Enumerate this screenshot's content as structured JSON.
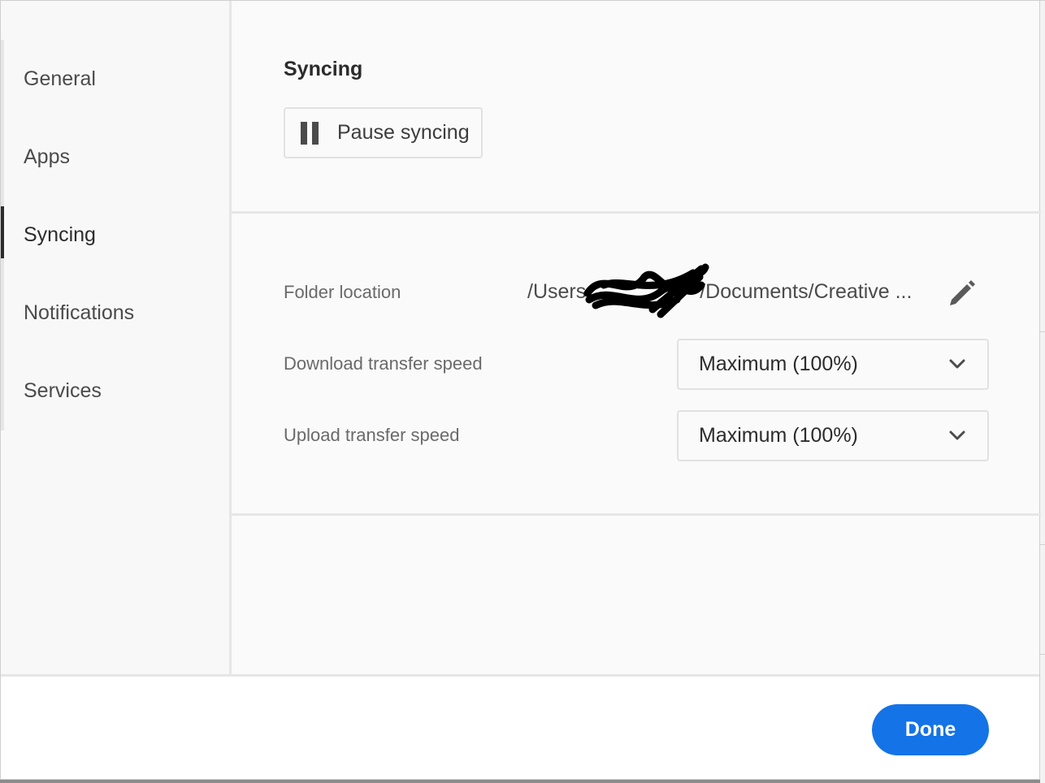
{
  "sidebar": {
    "items": [
      {
        "label": "General"
      },
      {
        "label": "Apps"
      },
      {
        "label": "Syncing"
      },
      {
        "label": "Notifications"
      },
      {
        "label": "Services"
      }
    ],
    "active_index": 2
  },
  "syncing": {
    "title": "Syncing",
    "pause_label": "Pause syncing"
  },
  "settings": {
    "folder_location": {
      "label": "Folder location",
      "path_prefix": "/Users",
      "path_suffix": "/Documents/Creative ..."
    },
    "download_speed": {
      "label": "Download transfer speed",
      "value": "Maximum (100%)"
    },
    "upload_speed": {
      "label": "Upload transfer speed",
      "value": "Maximum (100%)"
    }
  },
  "footer": {
    "done_label": "Done"
  },
  "colors": {
    "accent": "#1473e6",
    "active_indicator": "#2c2c2c"
  },
  "icons": [
    "pause-icon",
    "pencil-icon",
    "chevron-down-icon"
  ]
}
